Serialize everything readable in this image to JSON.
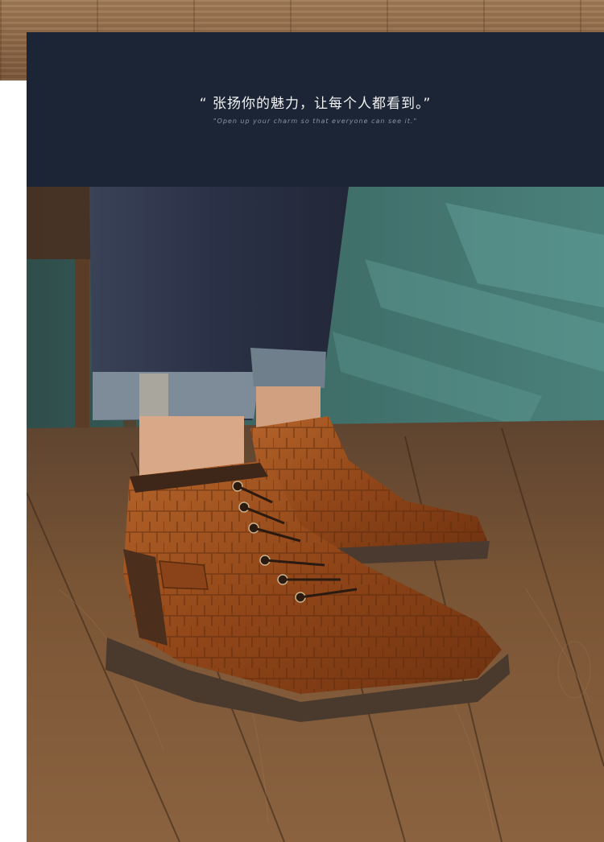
{
  "banner": {
    "quote_cn": "“ 张扬你的魅力，让每个人都看到。”",
    "quote_en": "\"Open up your charm so that everyone can see it.\""
  },
  "colors": {
    "banner_bg": "#1c2536",
    "wall": "#3d6a66",
    "floor": "#7a5233",
    "boot_leather": "#9a4f1f",
    "jeans": "#2d3448"
  },
  "photo": {
    "subject": "brown-leather-ankle-boots-photo"
  }
}
